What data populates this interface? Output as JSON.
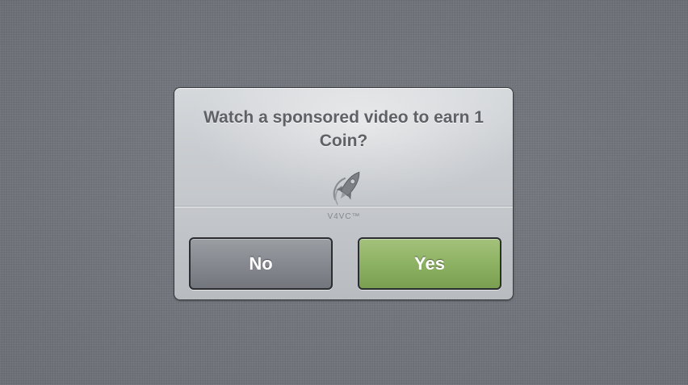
{
  "dialog": {
    "message": "Watch a sponsored video to earn 1 Coin?",
    "brand": {
      "icon": "rocket-icon",
      "text": "V4VC™"
    },
    "buttons": {
      "no_label": "No",
      "yes_label": "Yes"
    }
  },
  "colors": {
    "background": "#6e7178",
    "dialog_background": "#c9ccd0",
    "message_text": "#5f6166",
    "no_button": "#86898f",
    "yes_button": "#8eb263",
    "button_text": "#ffffff"
  }
}
